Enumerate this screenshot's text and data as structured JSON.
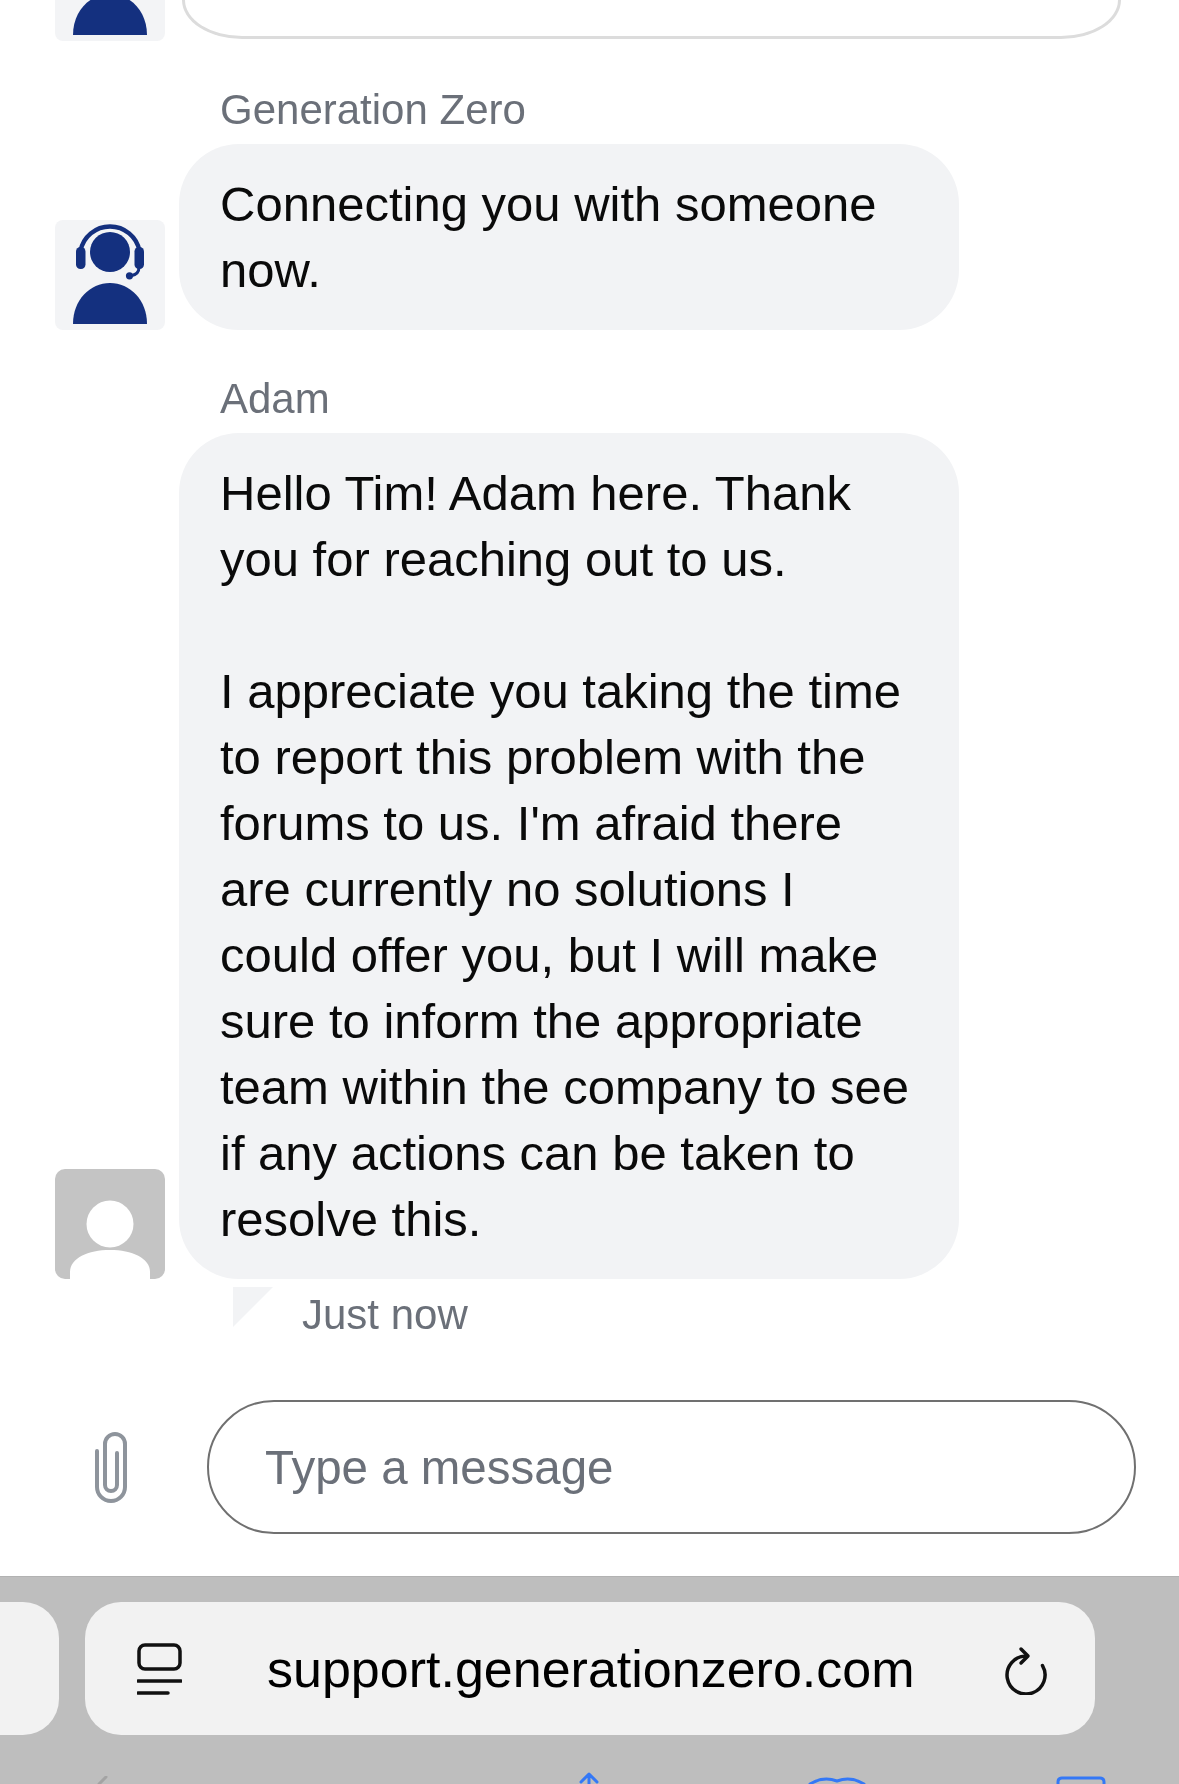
{
  "chat": {
    "previous_message": {
      "kind": "agent"
    },
    "messages": [
      {
        "sender": "Generation Zero",
        "kind": "agent",
        "paragraphs": [
          "Connecting you with someone now."
        ]
      },
      {
        "sender": "Adam",
        "kind": "generic",
        "paragraphs": [
          "Hello Tim! Adam here. Thank you for reaching out to us.",
          "I appreciate you taking the time to report this problem with the forums to us. I'm afraid there are currently no solutions I could offer you, but I will make sure to inform the appropriate team within the company to see if any actions can be taken to resolve this."
        ],
        "time": "Just now"
      }
    ]
  },
  "composer": {
    "placeholder": "Type a message"
  },
  "browser": {
    "url": "support.generationzero.com"
  }
}
